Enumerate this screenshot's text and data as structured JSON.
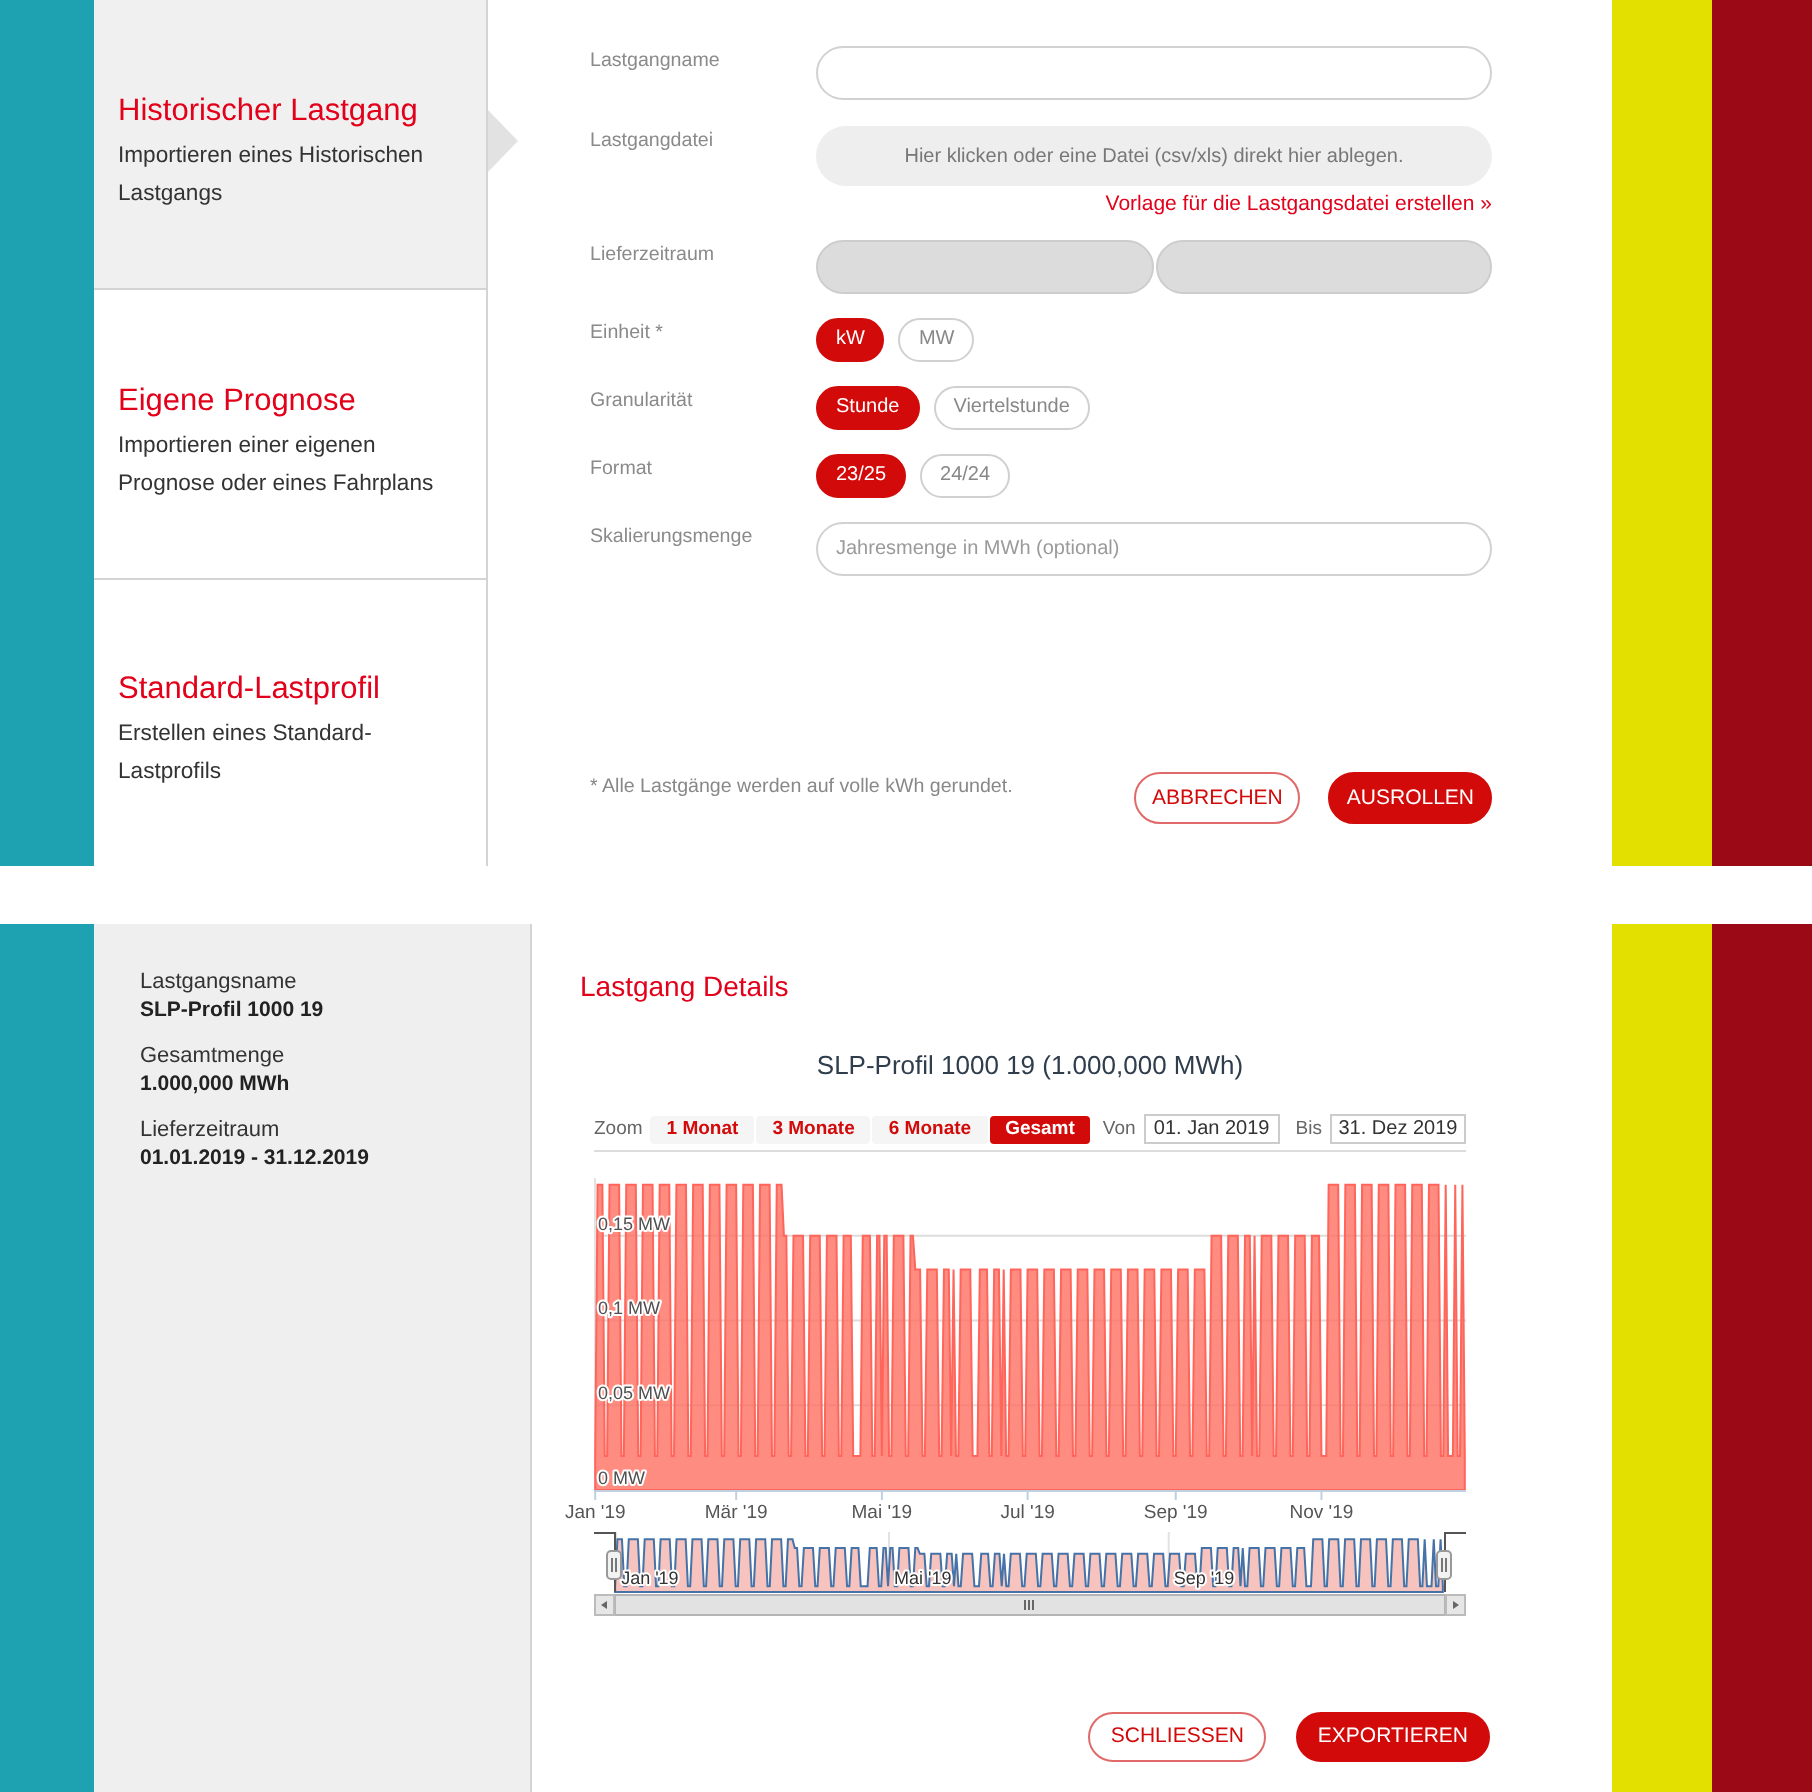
{
  "upload_dialog": {
    "sidebar": {
      "items": [
        {
          "title": "Historischer Lastgang",
          "description": "Importieren eines Historischen Lastgangs",
          "selected": true
        },
        {
          "title": "Eigene Prognose",
          "description": "Importieren einer eigenen Prognose oder eines Fahrplans",
          "selected": false
        },
        {
          "title": "Standard-Lastprofil",
          "description": "Erstellen eines Standard-Lastprofils",
          "selected": false
        }
      ]
    },
    "form": {
      "name_field": {
        "label": "Lastgangname"
      },
      "file_field": {
        "label": "Lastgangdatei",
        "drop_text": "Hier klicken oder eine Datei (csv/xls) direkt hier ablegen.",
        "template_link": "Vorlage für die Lastgangsdatei erstellen »"
      },
      "period_field": {
        "label": "Lieferzeitraum"
      },
      "toggle_groups": [
        {
          "label": "Einheit *",
          "options": [
            {
              "label": "kW",
              "selected": true
            },
            {
              "label": "MW",
              "selected": false
            }
          ]
        },
        {
          "label": "Granularität",
          "options": [
            {
              "label": "Stunde",
              "selected": true
            },
            {
              "label": "Viertelstunde",
              "selected": false
            }
          ]
        },
        {
          "label": "Format",
          "options": [
            {
              "label": "23/25",
              "selected": true
            },
            {
              "label": "24/24",
              "selected": false
            }
          ]
        }
      ],
      "scaling_field": {
        "label": "Skalierungsmenge",
        "placeholder": "Jahresmenge in MWh (optional)"
      },
      "note": "* Alle Lastgänge werden auf volle kWh gerundet.",
      "buttons": [
        {
          "label": "ABBRECHEN",
          "kind": "secondary"
        },
        {
          "label": "AUSROLLEN",
          "kind": "primary"
        }
      ]
    }
  },
  "details_view": {
    "summary": [
      {
        "label": "Lastgangsname",
        "value": "SLP-Profil 1000 19"
      },
      {
        "label": "Gesamtmenge",
        "value": "1.000,000 MWh"
      },
      {
        "label": "Lieferzeitraum",
        "value": "01.01.2019 - 31.12.2019"
      }
    ],
    "title": "Lastgang Details",
    "chart": {
      "range_selector": {
        "label": "Zoom",
        "buttons": [
          {
            "label": "1 Monat",
            "selected": false
          },
          {
            "label": "3 Monate",
            "selected": false
          },
          {
            "label": "6 Monate",
            "selected": false
          },
          {
            "label": "Gesamt",
            "selected": true
          }
        ],
        "from_label": "Von",
        "from_value": "01. Jan 2019",
        "to_label": "Bis",
        "to_value": "31. Dez 2019"
      },
      "chart_data": {
        "type": "area",
        "title": "SLP-Profil 1000 19 (1.000,000 MWh)",
        "grid": true,
        "ylim": [
          0,
          0.184
        ],
        "yticks": [
          {
            "value": 0,
            "label": "0 MW"
          },
          {
            "value": 0.05,
            "label": "0,05 MW"
          },
          {
            "value": 0.1,
            "label": "0,1 MW"
          },
          {
            "value": 0.15,
            "label": "0,15 MW"
          }
        ],
        "categories": [
          "Jan '19",
          null,
          null,
          null,
          null,
          null,
          null,
          null,
          null,
          null,
          null,
          null,
          null,
          null,
          null,
          null,
          null,
          null,
          null,
          null,
          null,
          null,
          null,
          null,
          null,
          null,
          null,
          null,
          null,
          null,
          null,
          null,
          null,
          null,
          null,
          null,
          null,
          null,
          null,
          null,
          null,
          null,
          null,
          null,
          null,
          null,
          null,
          null,
          null,
          null,
          null,
          null,
          null,
          null,
          null,
          null,
          null,
          null,
          null,
          "Mär '19",
          null,
          null,
          null,
          null,
          null,
          null,
          null,
          null,
          null,
          null,
          null,
          null,
          null,
          null,
          null,
          null,
          null,
          null,
          null,
          null,
          null,
          null,
          null,
          null,
          null,
          null,
          null,
          null,
          null,
          null,
          null,
          null,
          null,
          null,
          null,
          null,
          null,
          null,
          null,
          null,
          null,
          null,
          null,
          null,
          null,
          null,
          null,
          null,
          null,
          null,
          null,
          null,
          null,
          null,
          null,
          null,
          null,
          null,
          null,
          null,
          "Mai '19",
          null,
          null,
          null,
          null,
          null,
          null,
          null,
          null,
          null,
          null,
          null,
          null,
          null,
          null,
          null,
          null,
          null,
          null,
          null,
          null,
          null,
          null,
          null,
          null,
          null,
          null,
          null,
          null,
          null,
          null,
          null,
          null,
          null,
          null,
          null,
          null,
          null,
          null,
          null,
          null,
          null,
          null,
          null,
          null,
          null,
          null,
          null,
          null,
          null,
          null,
          null,
          null,
          null,
          null,
          null,
          null,
          null,
          null,
          null,
          null,
          "Jul '19",
          null,
          null,
          null,
          null,
          null,
          null,
          null,
          null,
          null,
          null,
          null,
          null,
          null,
          null,
          null,
          null,
          null,
          null,
          null,
          null,
          null,
          null,
          null,
          null,
          null,
          null,
          null,
          null,
          null,
          null,
          null,
          null,
          null,
          null,
          null,
          null,
          null,
          null,
          null,
          null,
          null,
          null,
          null,
          null,
          null,
          null,
          null,
          null,
          null,
          null,
          null,
          null,
          null,
          null,
          null,
          null,
          null,
          null,
          null,
          null,
          null,
          "Sep '19",
          null,
          null,
          null,
          null,
          null,
          null,
          null,
          null,
          null,
          null,
          null,
          null,
          null,
          null,
          null,
          null,
          null,
          null,
          null,
          null,
          null,
          null,
          null,
          null,
          null,
          null,
          null,
          null,
          null,
          null,
          null,
          null,
          null,
          null,
          null,
          null,
          null,
          null,
          null,
          null,
          null,
          null,
          null,
          null,
          null,
          null,
          null,
          null,
          null,
          null,
          null,
          null,
          null,
          null,
          null,
          null,
          null,
          null,
          null,
          null,
          "Nov '19",
          null,
          null,
          null,
          null,
          null,
          null,
          null,
          null,
          null,
          null,
          null,
          null,
          null,
          null,
          null,
          null,
          null,
          null,
          null,
          null,
          null,
          null,
          null,
          null,
          null,
          null,
          null,
          null,
          null,
          null,
          null,
          null,
          null,
          null,
          null,
          null,
          null,
          null,
          null,
          null,
          null,
          null,
          null,
          null,
          null,
          null,
          null,
          null,
          null,
          null,
          null,
          null,
          null,
          null,
          null,
          null,
          null,
          null,
          null,
          null
        ],
        "values": [
          0.02,
          0.18,
          0.18,
          0.18,
          0.02,
          0.02,
          0.18,
          0.18,
          0.18,
          0.18,
          0.18,
          0.02,
          0.02,
          0.18,
          0.18,
          0.18,
          0.18,
          0.18,
          0.02,
          0.02,
          0.18,
          0.18,
          0.18,
          0.18,
          0.18,
          0.02,
          0.02,
          0.18,
          0.18,
          0.18,
          0.18,
          0.18,
          0.02,
          0.02,
          0.18,
          0.18,
          0.18,
          0.18,
          0.18,
          0.02,
          0.02,
          0.18,
          0.18,
          0.18,
          0.18,
          0.18,
          0.02,
          0.02,
          0.18,
          0.18,
          0.18,
          0.18,
          0.18,
          0.02,
          0.02,
          0.18,
          0.18,
          0.18,
          0.18,
          0.18,
          0.02,
          0.02,
          0.18,
          0.18,
          0.18,
          0.18,
          0.18,
          0.02,
          0.02,
          0.18,
          0.18,
          0.18,
          0.18,
          0.18,
          0.02,
          0.02,
          0.18,
          0.18,
          0.18,
          0.15,
          0.15,
          0.02,
          0.02,
          0.15,
          0.15,
          0.15,
          0.15,
          0.15,
          0.02,
          0.02,
          0.15,
          0.15,
          0.15,
          0.15,
          0.15,
          0.02,
          0.02,
          0.15,
          0.15,
          0.15,
          0.15,
          0.15,
          0.02,
          0.02,
          0.15,
          0.15,
          0.15,
          0.15,
          0.02,
          0.02,
          0.02,
          0.02,
          0.15,
          0.15,
          0.15,
          0.15,
          0.02,
          0.02,
          0.15,
          0.15,
          0.02,
          0.15,
          0.15,
          0.02,
          0.02,
          0.15,
          0.15,
          0.15,
          0.15,
          0.15,
          0.02,
          0.02,
          0.15,
          0.15,
          0.13,
          0.13,
          0.13,
          0.02,
          0.02,
          0.13,
          0.13,
          0.13,
          0.13,
          0.13,
          0.02,
          0.02,
          0.13,
          0.13,
          0.13,
          0.02,
          0.13,
          0.02,
          0.02,
          0.13,
          0.13,
          0.13,
          0.13,
          0.13,
          0.02,
          0.02,
          0.02,
          0.13,
          0.13,
          0.13,
          0.13,
          0.02,
          0.02,
          0.13,
          0.13,
          0.13,
          0.02,
          0.13,
          0.02,
          0.02,
          0.13,
          0.13,
          0.13,
          0.13,
          0.13,
          0.02,
          0.02,
          0.13,
          0.13,
          0.13,
          0.13,
          0.13,
          0.02,
          0.02,
          0.13,
          0.13,
          0.13,
          0.13,
          0.13,
          0.02,
          0.02,
          0.13,
          0.13,
          0.13,
          0.13,
          0.13,
          0.02,
          0.02,
          0.13,
          0.13,
          0.13,
          0.13,
          0.13,
          0.02,
          0.02,
          0.13,
          0.13,
          0.13,
          0.13,
          0.13,
          0.02,
          0.02,
          0.13,
          0.13,
          0.13,
          0.13,
          0.13,
          0.02,
          0.02,
          0.13,
          0.13,
          0.13,
          0.13,
          0.13,
          0.02,
          0.02,
          0.13,
          0.13,
          0.13,
          0.13,
          0.13,
          0.02,
          0.02,
          0.13,
          0.13,
          0.13,
          0.13,
          0.13,
          0.02,
          0.02,
          0.13,
          0.13,
          0.13,
          0.13,
          0.13,
          0.02,
          0.02,
          0.13,
          0.13,
          0.13,
          0.13,
          0.13,
          0.02,
          0.02,
          0.15,
          0.15,
          0.15,
          0.15,
          0.15,
          0.02,
          0.02,
          0.15,
          0.15,
          0.15,
          0.15,
          0.15,
          0.02,
          0.02,
          0.15,
          0.15,
          0.15,
          0.02,
          0.15,
          0.02,
          0.02,
          0.15,
          0.15,
          0.15,
          0.15,
          0.15,
          0.02,
          0.02,
          0.15,
          0.15,
          0.15,
          0.15,
          0.15,
          0.02,
          0.02,
          0.15,
          0.15,
          0.15,
          0.15,
          0.15,
          0.02,
          0.02,
          0.15,
          0.15,
          0.15,
          0.15,
          0.02,
          0.02,
          0.02,
          0.18,
          0.18,
          0.18,
          0.18,
          0.18,
          0.02,
          0.02,
          0.18,
          0.18,
          0.18,
          0.18,
          0.18,
          0.02,
          0.02,
          0.18,
          0.18,
          0.18,
          0.18,
          0.18,
          0.02,
          0.02,
          0.18,
          0.18,
          0.18,
          0.18,
          0.18,
          0.02,
          0.02,
          0.18,
          0.18,
          0.18,
          0.18,
          0.18,
          0.02,
          0.02,
          0.18,
          0.18,
          0.18,
          0.18,
          0.18,
          0.02,
          0.02,
          0.18,
          0.18,
          0.18,
          0.18,
          0.18,
          0.02,
          0.02,
          0.18,
          0.02,
          0.02,
          0.02,
          0.18,
          0.02,
          0.02,
          0.18,
          0.02
        ]
      },
      "navigator": {
        "labels": [
          "Jan '19",
          "Mai '19",
          "Sep '19"
        ]
      }
    },
    "buttons": [
      {
        "label": "SCHLIESSEN",
        "kind": "secondary"
      },
      {
        "label": "EXPORTIEREN",
        "kind": "primary"
      }
    ]
  }
}
